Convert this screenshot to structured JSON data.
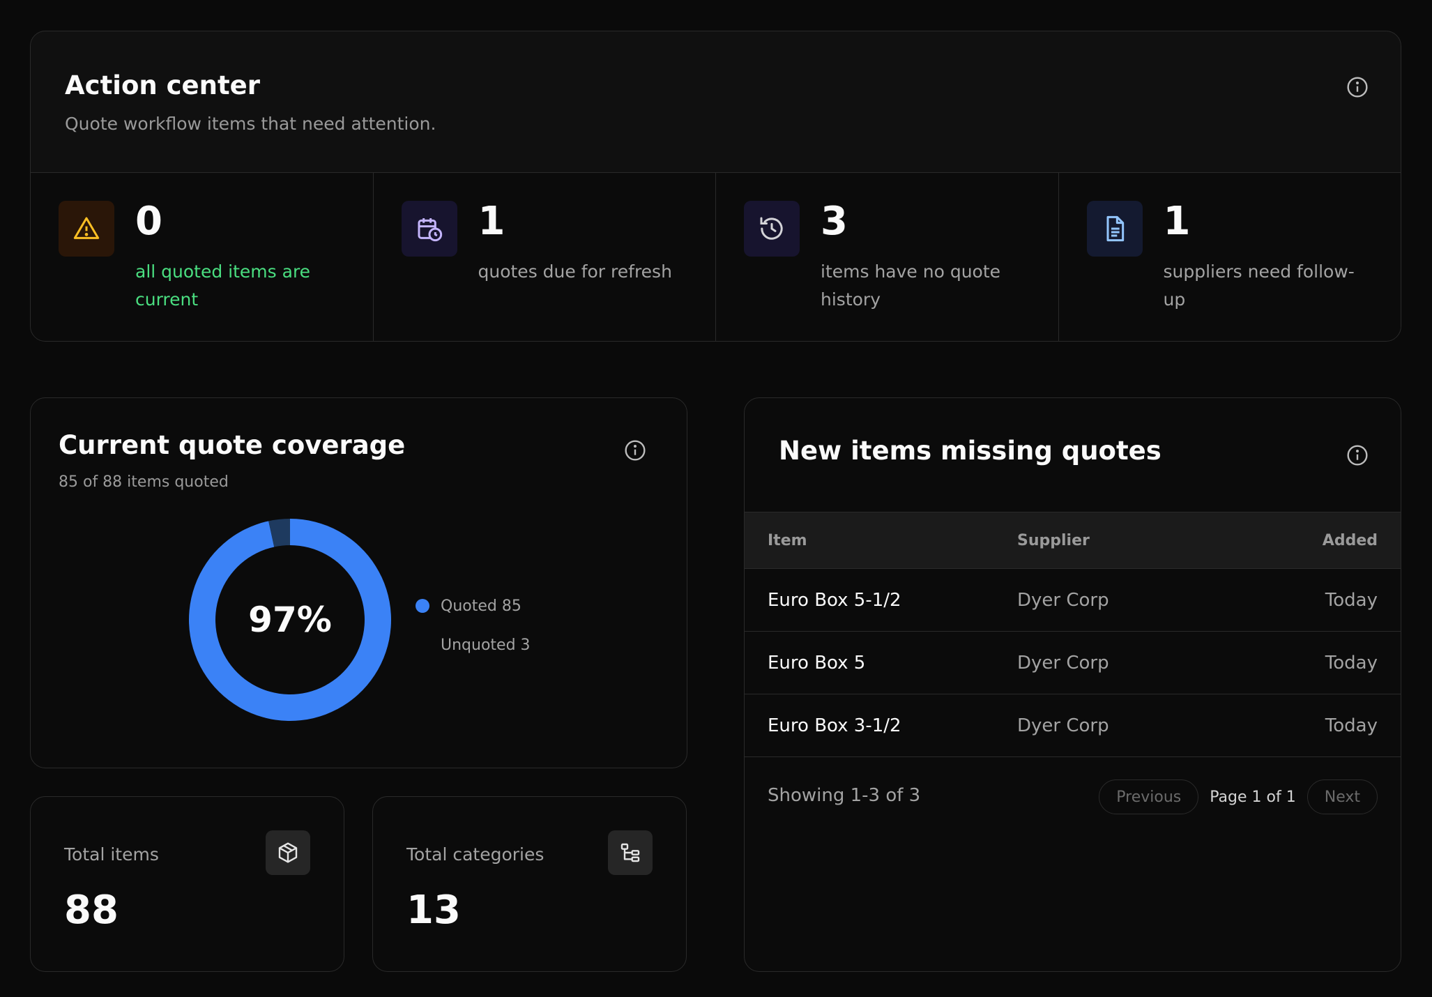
{
  "action_center": {
    "title": "Action center",
    "subtitle": "Quote workflow items that need attention.",
    "stats": [
      {
        "icon": "warning-icon",
        "value": "0",
        "label": "all quoted items are current",
        "accent": "#fbbf24",
        "label_color": "#4ade80"
      },
      {
        "icon": "calendar-clock-icon",
        "value": "1",
        "label": "quotes due for refresh",
        "accent": "#c4b5fd"
      },
      {
        "icon": "history-icon",
        "value": "3",
        "label": "items have no quote history",
        "accent": "#c4b5fd"
      },
      {
        "icon": "document-icon",
        "value": "1",
        "label": "suppliers need follow-up",
        "accent": "#93c5fd"
      }
    ]
  },
  "coverage": {
    "title": "Current quote coverage",
    "subtitle": "85 of 88 items quoted",
    "percent_label": "97%",
    "legend": [
      {
        "label": "Quoted 85",
        "color": "#3b82f6"
      },
      {
        "label": "Unquoted 3",
        "color": "#1e3a5f"
      }
    ]
  },
  "chart_data": {
    "type": "pie",
    "categories": [
      "Quoted",
      "Unquoted"
    ],
    "values": [
      85,
      3
    ],
    "colors": [
      "#3b82f6",
      "#1e3a5f"
    ]
  },
  "totals": {
    "items": {
      "label": "Total items",
      "value": "88",
      "icon": "package-icon"
    },
    "categories": {
      "label": "Total categories",
      "value": "13",
      "icon": "tree-icon"
    }
  },
  "missing": {
    "title": "New items missing quotes",
    "columns": {
      "item": "Item",
      "supplier": "Supplier",
      "added": "Added"
    },
    "rows": [
      {
        "item": "Euro Box 5-1/2",
        "supplier": "Dyer Corp",
        "added": "Today"
      },
      {
        "item": "Euro Box 5",
        "supplier": "Dyer Corp",
        "added": "Today"
      },
      {
        "item": "Euro Box 3-1/2",
        "supplier": "Dyer Corp",
        "added": "Today"
      }
    ],
    "showing": "Showing 1-3 of 3",
    "prev_label": "Previous",
    "page_label": "Page 1 of 1",
    "next_label": "Next"
  }
}
